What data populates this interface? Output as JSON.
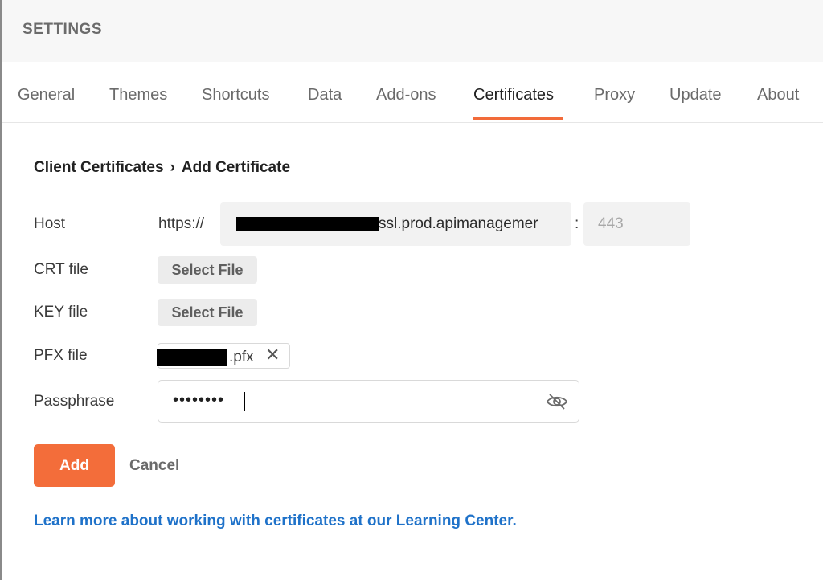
{
  "header": {
    "title": "SETTINGS"
  },
  "tabs": [
    {
      "label": "General"
    },
    {
      "label": "Themes"
    },
    {
      "label": "Shortcuts"
    },
    {
      "label": "Data"
    },
    {
      "label": "Add-ons"
    },
    {
      "label": "Certificates"
    },
    {
      "label": "Proxy"
    },
    {
      "label": "Update"
    },
    {
      "label": "About"
    }
  ],
  "active_tab": "Certificates",
  "breadcrumb": {
    "parent": "Client Certificates",
    "separator": "›",
    "current": "Add Certificate"
  },
  "form": {
    "host_label": "Host",
    "host_prefix": "https://",
    "host_value_visible": "ssl.prod.apimanagemer",
    "port_separator": ":",
    "port_placeholder": "443",
    "crt_label": "CRT file",
    "crt_button": "Select File",
    "key_label": "KEY file",
    "key_button": "Select File",
    "pfx_label": "PFX file",
    "pfx_file_suffix": ".pfx",
    "pfx_remove": "✕",
    "passphrase_label": "Passphrase",
    "passphrase_value": "••••••••",
    "eye_icon": "eye-slash-icon"
  },
  "actions": {
    "add": "Add",
    "cancel": "Cancel"
  },
  "learn_link": "Learn more about working with certificates at our Learning Center.",
  "colors": {
    "accent": "#f26b3a",
    "link": "#1f72c9"
  }
}
